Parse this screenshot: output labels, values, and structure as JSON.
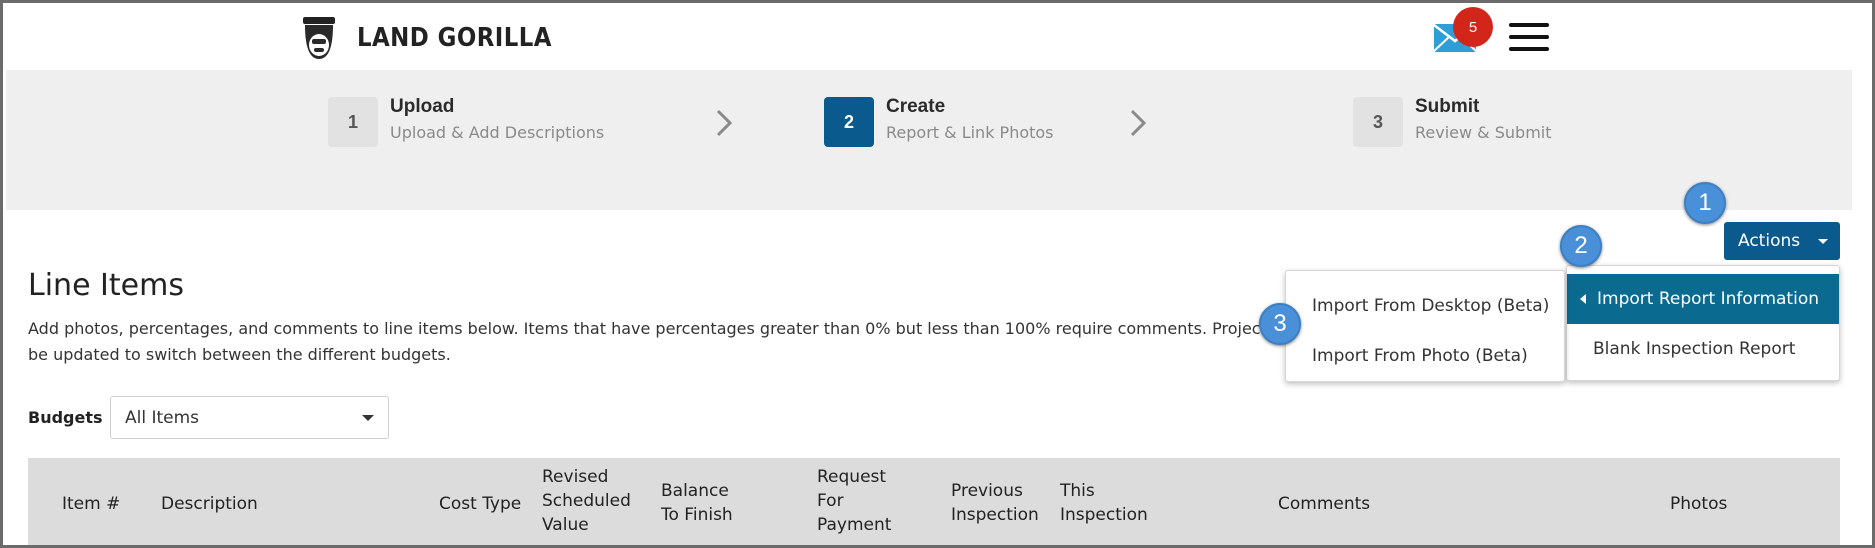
{
  "brand": {
    "name": "LAND GORILLA"
  },
  "header": {
    "mail_count": "5"
  },
  "steps": [
    {
      "num": "1",
      "title": "Upload",
      "sub": "Upload & Add Descriptions",
      "active": false
    },
    {
      "num": "2",
      "title": "Create",
      "sub": "Report & Link Photos",
      "active": true
    },
    {
      "num": "3",
      "title": "Submit",
      "sub": "Review & Submit",
      "active": false
    }
  ],
  "main": {
    "title": "Line Items",
    "description": "Add photos, percentages, and comments to line items below. Items that have percentages greater than 0% but less than 100% require comments. Projects with mo",
    "description_line2": "be updated to switch between the different budgets.",
    "budgets_label": "Budgets",
    "budgets_value": "All Items"
  },
  "table": {
    "headers": [
      "Item #",
      "Description",
      "Cost Type",
      "Revised Scheduled Value",
      "Balance To Finish",
      "Request For Payment",
      "Previous Inspection",
      "This Inspection",
      "Comments",
      "Photos"
    ]
  },
  "actions": {
    "label": "Actions",
    "menu": [
      "Import Report Information",
      "Blank Inspection Report"
    ],
    "submenu": [
      "Import From Desktop (Beta)",
      "Import From Photo (Beta)"
    ]
  },
  "callouts": [
    "1",
    "2",
    "3"
  ],
  "colors": {
    "primary": "#0b5a8e",
    "highlight": "#0b6a8f",
    "badge": "#d2261b",
    "callout": "#4a90d9"
  }
}
